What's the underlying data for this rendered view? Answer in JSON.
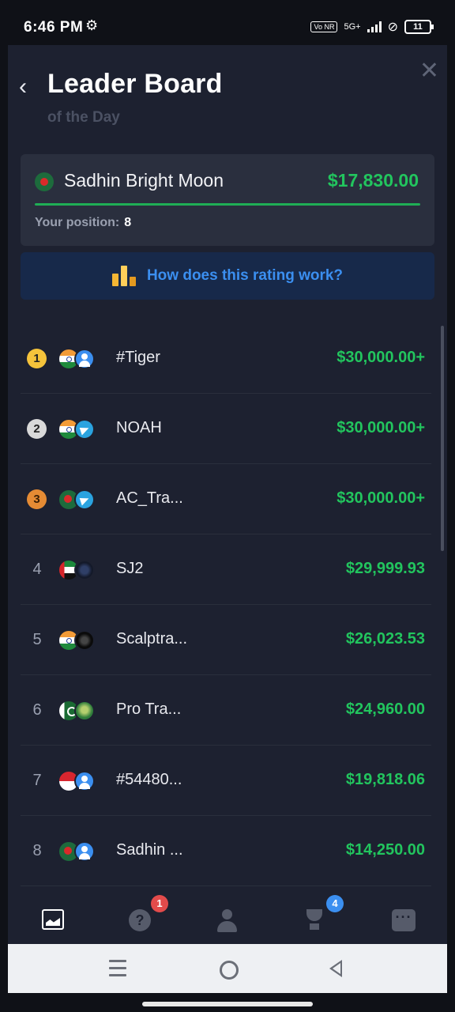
{
  "status": {
    "time": "6:46 PM",
    "network": "5G+",
    "carrier_badge": "Vo NR",
    "battery": "11"
  },
  "header": {
    "title": "Leader Board",
    "subtitle": "of the Day"
  },
  "my_card": {
    "name": "Sadhin Bright Moon",
    "amount": "$17,830.00",
    "position_label": "Your position:",
    "position_value": "8"
  },
  "rating_link": "How does this rating work?",
  "leaderboard": [
    {
      "rank": "1",
      "medal": "gold",
      "flag": "in",
      "avatar": "user",
      "name": "#Tiger",
      "amount": "$30,000.00+"
    },
    {
      "rank": "2",
      "medal": "silver",
      "flag": "in",
      "avatar": "tg",
      "name": "NOAH",
      "amount": "$30,000.00+"
    },
    {
      "rank": "3",
      "medal": "bronze",
      "flag": "bd",
      "avatar": "tg",
      "name": "AC_Tra...",
      "amount": "$30,000.00+"
    },
    {
      "rank": "4",
      "medal": "",
      "flag": "ae",
      "avatar": "dark",
      "name": "SJ2",
      "amount": "$29,999.93"
    },
    {
      "rank": "5",
      "medal": "",
      "flag": "in",
      "avatar": "black",
      "name": "Scalptra...",
      "amount": "$26,023.53"
    },
    {
      "rank": "6",
      "medal": "",
      "flag": "pk",
      "avatar": "green",
      "name": "Pro Tra...",
      "amount": "$24,960.00"
    },
    {
      "rank": "7",
      "medal": "",
      "flag": "id",
      "avatar": "user",
      "name": "#54480...",
      "amount": "$19,818.06"
    },
    {
      "rank": "8",
      "medal": "",
      "flag": "bd",
      "avatar": "user",
      "name": "Sadhin ...",
      "amount": "$14,250.00"
    }
  ],
  "tabbar": {
    "chart_icon": "chart-icon",
    "help_icon": "question-icon",
    "help_badge": "1",
    "profile_icon": "user-icon",
    "trophy_icon": "trophy-icon",
    "trophy_badge": "4",
    "more_icon": "more-icon"
  },
  "colors": {
    "accent_green": "#22c55e",
    "link_blue": "#3b8ff0",
    "panel_bg": "#1d2130"
  }
}
